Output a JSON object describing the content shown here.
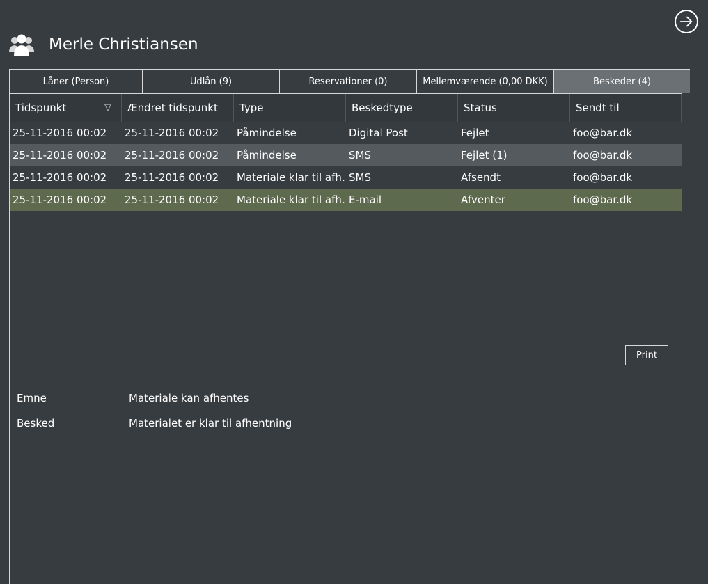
{
  "header": {
    "title": "Merle Christiansen",
    "icon": "users-icon",
    "exit_icon": "arrow-right-circle-icon"
  },
  "tabs": [
    {
      "label": "Låner (Person)"
    },
    {
      "label": "Udlån (9)"
    },
    {
      "label": "Reservationer (0)"
    },
    {
      "label": "Mellemværende (0,00 DKK)"
    },
    {
      "label": "Beskeder (4)",
      "active": true
    }
  ],
  "grid": {
    "columns": [
      "Tidspunkt",
      "Ændret tidspunkt",
      "Type",
      "Beskedtype",
      "Status",
      "Sendt til"
    ],
    "sort_icon": "sort-descending-icon",
    "rows": [
      [
        "25-11-2016 00:02",
        "25-11-2016 00:02",
        "Påmindelse",
        "Digital Post",
        "Fejlet",
        "foo@bar.dk"
      ],
      [
        "25-11-2016 00:02",
        "25-11-2016 00:02",
        "Påmindelse",
        "SMS",
        "Fejlet (1)",
        "foo@bar.dk"
      ],
      [
        "25-11-2016 00:02",
        "25-11-2016 00:02",
        "Materiale klar til afh…",
        "SMS",
        "Afsendt",
        "foo@bar.dk"
      ],
      [
        "25-11-2016 00:02",
        "25-11-2016 00:02",
        "Materiale klar til afh…",
        "E-mail",
        "Afventer",
        "foo@bar.dk"
      ]
    ],
    "selected_row": 3
  },
  "detail": {
    "print_label": "Print",
    "subject_label": "Emne",
    "subject_value": "Materiale kan afhentes",
    "message_label": "Besked",
    "message_value": "Materialet er klar til afhentning"
  },
  "colors": {
    "background": "#373c40",
    "active_tab": "#6b7074",
    "alt_row": "#555a5e",
    "selected_row": "#5e6a4e"
  }
}
